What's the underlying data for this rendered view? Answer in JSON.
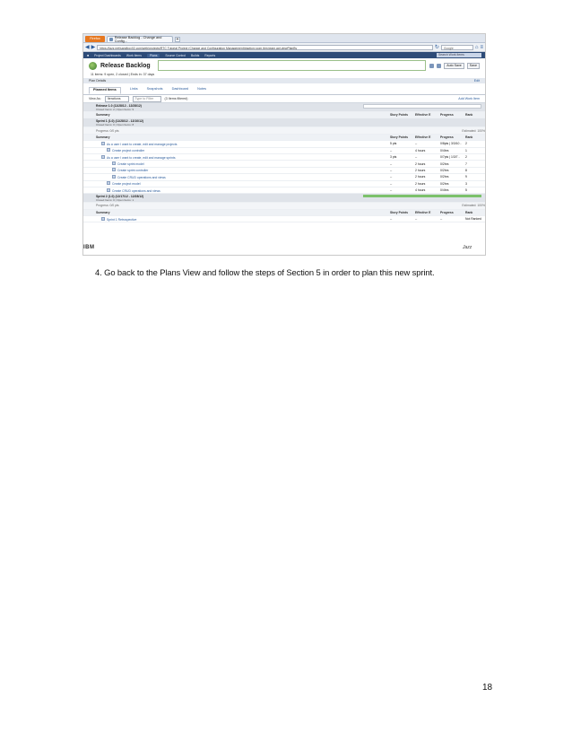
{
  "screenshot": {
    "browser": {
      "menu_button": "Firefox",
      "tab_title": "Release Backlog - Change and Config...",
      "new_tab": "+",
      "url": "https://jazz.net/sandbox02-ccm/web/projects/RTC Tutorial Project (Change and Configuration Management)#action=com.ibm.team.apt.viewPlanBy",
      "search_placeholder": "Google"
    },
    "jazz_nav": {
      "items": [
        "Project Dashboards",
        "Work Items",
        "Plans",
        "Source Control",
        "Builds",
        "Reports"
      ],
      "search": "Search Work Items"
    },
    "header": {
      "title": "Release Backlog",
      "auto_save": "Auto Save",
      "save": "Save"
    },
    "subinfo": "11 items: 9 open, 2 closed | Ends in: 37 days",
    "plan_details": {
      "label": "Plan Details",
      "edit": "Edit"
    },
    "plan_tabs": [
      "Planned Items",
      "Links",
      "Snapshots",
      "Dashboard",
      "Notes"
    ],
    "toolbar": {
      "view_as_label": "View As:",
      "view_as_value": "Iterations",
      "filter_placeholder": "Type to Filter",
      "items_filtered": "(3 Items filtered)",
      "add_work_item": "Add Work Item"
    },
    "groups": [
      {
        "title": "Release 1.0",
        "dates": "(11/28/12 - 12/28/12)",
        "sub": "Closed Items: 2 | Open Items: 9",
        "progress_label": "Progress: 0/0 pts",
        "estimated": "Estimated: 100%",
        "columns": [
          "Summary",
          "Story Points",
          "Effective E",
          "Progress",
          "Rank"
        ]
      },
      {
        "title": "Sprint 1 (1.0)",
        "dates": "(11/28/12 - 12/10/12)",
        "sub": "Closed Items: 0 | Open Items: 8",
        "progress_label": "Progress: 0/0 pts",
        "estimated": "Estimated: 100%",
        "columns": [
          "Summary",
          "Story Points",
          "Effective E",
          "Progress",
          "Rank"
        ],
        "rows": [
          {
            "indent": 1,
            "summary": "As a user I want to create, edit and manage projects",
            "points": "5 pts",
            "effort": "--",
            "progress": "0/8pts | 3/3/10 -",
            "rank": "2"
          },
          {
            "indent": 2,
            "summary": "Create project controller",
            "points": "--",
            "effort": "4 hours",
            "progress": "0/4hrs",
            "rank": "1"
          },
          {
            "indent": 1,
            "summary": "As a user I want to create, edit and manage sprints",
            "points": "3 pts",
            "effort": "--",
            "progress": "0/7pts | 1/3/7 -",
            "rank": "2"
          },
          {
            "indent": 3,
            "summary": "Create sprint model",
            "points": "--",
            "effort": "2 hours",
            "progress": "0/2hrs",
            "rank": "7"
          },
          {
            "indent": 3,
            "summary": "Create sprint controller",
            "points": "--",
            "effort": "2 hours",
            "progress": "0/2hrs",
            "rank": "8"
          },
          {
            "indent": 3,
            "summary": "Create CRUD operations and views",
            "points": "--",
            "effort": "2 hours",
            "progress": "0/2hrs",
            "rank": "9"
          },
          {
            "indent": 2,
            "summary": "Create project model",
            "points": "--",
            "effort": "2 hours",
            "progress": "0/2hrs",
            "rank": "3"
          },
          {
            "indent": 2,
            "summary": "Create CRUD operations and views",
            "points": "--",
            "effort": "4 hours",
            "progress": "0/4hrs",
            "rank": "5"
          }
        ]
      },
      {
        "title": "Sprint 2 (1.0)",
        "dates": "(12/17/12 - 12/28/12)",
        "sub": "Closed Items: 0 | Open Items: 1",
        "progress_label": "Progress: 0/0 pts",
        "estimated": "Estimated: 100%",
        "columns": [
          "Summary",
          "Story Points",
          "Effective E",
          "Progress",
          "Rank"
        ],
        "rows": [
          {
            "indent": 1,
            "summary": "Sprint 1 Retrospective",
            "points": "--",
            "effort": "--",
            "progress": "--",
            "rank": "Not Ranked"
          }
        ]
      }
    ],
    "footer_left": "IBM",
    "footer_right": "Jazz"
  },
  "instruction": "4.   Go back to the Plans View and follow the steps of Section 5 in order to plan this new sprint.",
  "page_number": "18"
}
